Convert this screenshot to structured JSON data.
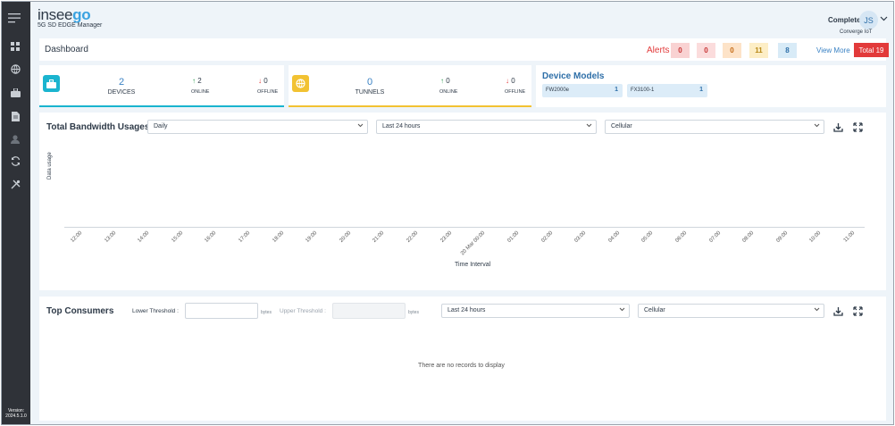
{
  "app": {
    "logo_main": "insee",
    "logo_accent": "go",
    "product": "5G SD EDGE Manager",
    "version_label": "Version:",
    "version": "2024.5.1.0"
  },
  "user": {
    "name": "Complete",
    "initials": "JS",
    "org": "Converge IoT"
  },
  "sidebar": {
    "icons": [
      "menu-icon",
      "dashboard-icon",
      "globe-icon",
      "devices-icon",
      "document-icon",
      "user-icon",
      "sync-icon",
      "tools-icon"
    ]
  },
  "header": {
    "title": "Dashboard",
    "alerts_label": "Alerts",
    "alerts": [
      {
        "value": "0",
        "bg": "#f9d2d2",
        "fg": "#c63333"
      },
      {
        "value": "0",
        "bg": "#fbdcdc",
        "fg": "#c63333"
      },
      {
        "value": "0",
        "bg": "#fde3c8",
        "fg": "#c46a14"
      },
      {
        "value": "11",
        "bg": "#fdeec6",
        "fg": "#b78714"
      },
      {
        "value": "8",
        "bg": "#d8ebf7",
        "fg": "#2e6fa8"
      }
    ],
    "view_more": "View More",
    "total_label": "Total",
    "total_value": "19"
  },
  "devices": {
    "count": "2",
    "label": "DEVICES",
    "online": "2",
    "online_label": "ONLINE",
    "offline": "0",
    "offline_label": "OFFLINE",
    "color": "#1ab4cf"
  },
  "tunnels": {
    "count": "0",
    "label": "TUNNELS",
    "online": "0",
    "online_label": "ONLINE",
    "offline": "0",
    "offline_label": "OFFLINE",
    "color": "#f2c232"
  },
  "models": {
    "title": "Device Models",
    "items": [
      {
        "name": "FW2000e",
        "count": "1"
      },
      {
        "name": "FX3100-1",
        "count": "1"
      }
    ]
  },
  "bandwidth": {
    "title": "Total Bandwidth Usages",
    "period": "Daily",
    "range": "Last 24 hours",
    "type": "Cellular",
    "ylabel": "Data usage",
    "xlabel": "Time Interval",
    "ticks": [
      "12:00",
      "13:00",
      "14:00",
      "15:00",
      "16:00",
      "17:00",
      "18:00",
      "19:00",
      "20:00",
      "21:00",
      "22:00",
      "23:00",
      "20 Mar 00:00",
      "01:00",
      "02:00",
      "03:00",
      "04:00",
      "05:00",
      "06:00",
      "07:00",
      "08:00",
      "09:00",
      "10:00",
      "11:00"
    ]
  },
  "consumers": {
    "title": "Top Consumers",
    "lower_label": "Lower Threshold :",
    "upper_label": "Upper Threshold :",
    "unit": "bytes",
    "range": "Last 24 hours",
    "type": "Cellular",
    "empty": "There are no records to display"
  }
}
